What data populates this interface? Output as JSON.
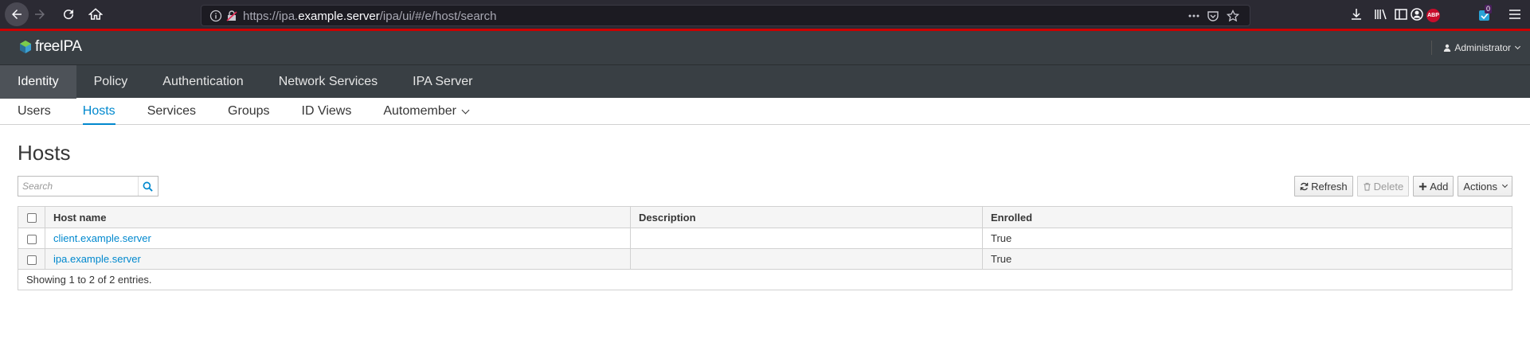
{
  "browser": {
    "url_prefix": "https://ipa.",
    "url_domain": "example.server",
    "url_path": "/ipa/ui/#/e/host/search",
    "ext_badge_count": "0",
    "abp_label": "ABP"
  },
  "app": {
    "logo_text": "freeIPA",
    "user_label": "Administrator"
  },
  "primary_nav": [
    {
      "label": "Identity"
    },
    {
      "label": "Policy"
    },
    {
      "label": "Authentication"
    },
    {
      "label": "Network Services"
    },
    {
      "label": "IPA Server"
    }
  ],
  "secondary_nav": [
    {
      "label": "Users"
    },
    {
      "label": "Hosts"
    },
    {
      "label": "Services"
    },
    {
      "label": "Groups"
    },
    {
      "label": "ID Views"
    },
    {
      "label": "Automember"
    }
  ],
  "page": {
    "title": "Hosts",
    "search_placeholder": "Search"
  },
  "actions": {
    "refresh": "Refresh",
    "delete": "Delete",
    "add": "Add",
    "actions": "Actions"
  },
  "table": {
    "columns": [
      "Host name",
      "Description",
      "Enrolled"
    ],
    "rows": [
      {
        "host": "client.example.server",
        "description": "",
        "enrolled": "True"
      },
      {
        "host": "ipa.example.server",
        "description": "",
        "enrolled": "True"
      }
    ],
    "footer": "Showing 1 to 2 of 2 entries."
  },
  "colors": {
    "accent": "#0088ce",
    "header_bg": "#393f44",
    "header_stripe": "#cc0000"
  }
}
